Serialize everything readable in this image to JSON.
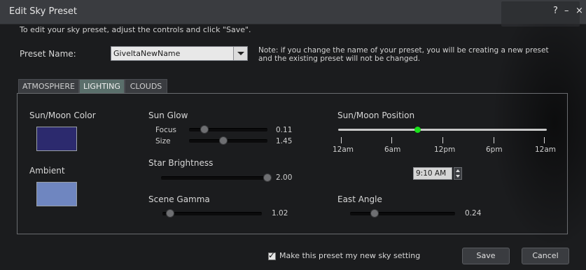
{
  "window": {
    "title": "Edit Sky Preset",
    "help_label": "?",
    "minimize_label": "–",
    "close_label": "×"
  },
  "intro_text": "To edit your sky preset, adjust the controls and click \"Save\".",
  "preset": {
    "label": "Preset Name:",
    "value": "GiveltaNewName",
    "note": "Note: if you change the name of your preset, you will be creating a new preset and the existing preset will not be changed."
  },
  "tabs": [
    {
      "label": "ATMOSPHERE"
    },
    {
      "label": "LIGHTING"
    },
    {
      "label": "CLOUDS"
    }
  ],
  "lighting": {
    "sun_moon_color_label": "Sun/Moon Color",
    "ambient_label": "Ambient",
    "sun_glow_label": "Sun Glow",
    "focus_label": "Focus",
    "focus_value": "0.11",
    "size_label": "Size",
    "size_value": "1.45",
    "star_brightness_label": "Star Brightness",
    "star_brightness_value": "2.00",
    "scene_gamma_label": "Scene Gamma",
    "scene_gamma_value": "1.02",
    "position_label": "Sun/Moon Position",
    "ticks": [
      "12am",
      "6am",
      "12pm",
      "6pm",
      "12am"
    ],
    "time_value": "9:10 AM",
    "east_angle_label": "East Angle",
    "east_angle_value": "0.24"
  },
  "colors": {
    "sun_moon_color": "#2c2a6e",
    "ambient": "#6f86c0",
    "active_tab": "#5a6f6b",
    "position_indicator": "#19e11a"
  },
  "footer": {
    "checkbox_label": "Make this preset my new sky setting",
    "checkbox_checked": true,
    "save_label": "Save",
    "cancel_label": "Cancel"
  }
}
